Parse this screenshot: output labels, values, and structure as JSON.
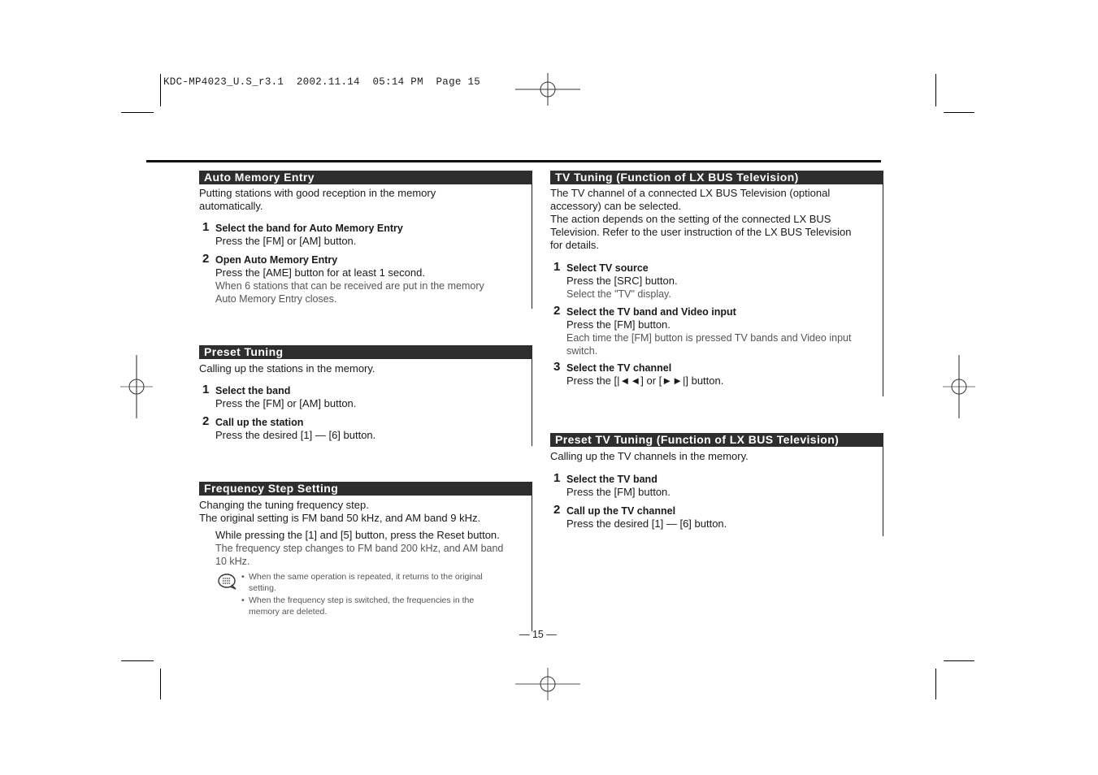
{
  "slug": {
    "file": "KDC-MP4023_U.S_r3.1",
    "date": "2002.11.14",
    "time": "05:14 PM",
    "page_label": "Page 15"
  },
  "left_column": {
    "auto_memory": {
      "title": "Auto Memory Entry",
      "intro": [
        "Putting stations with good reception in the memory",
        "automatically."
      ],
      "steps": [
        {
          "num": "1",
          "title": "Select the band for Auto Memory Entry",
          "action": "Press the [FM] or [AM] button.",
          "notes": []
        },
        {
          "num": "2",
          "title": "Open Auto Memory Entry",
          "action": "Press the [AME] button for at least 1 second.",
          "notes": [
            "When 6 stations that can be received are put in the memory",
            "Auto Memory Entry closes."
          ]
        }
      ]
    },
    "preset_tuning": {
      "title": "Preset Tuning",
      "intro": [
        "Calling up the stations in the memory."
      ],
      "steps": [
        {
          "num": "1",
          "title": "Select the band",
          "action": "Press the [FM] or [AM] button."
        },
        {
          "num": "2",
          "title": "Call up the station",
          "action": "Press the desired [1] — [6] button."
        }
      ]
    },
    "frequency_step": {
      "title": "Frequency Step Setting",
      "intro": [
        "Changing the tuning frequency step.",
        "The original setting is FM band 50 kHz, and AM band 9 kHz."
      ],
      "action": "While pressing the [1] and [5] button, press the Reset button.",
      "notes": [
        "The frequency step changes to FM band 200 kHz, and AM band",
        "10 kHz."
      ],
      "tips_icon": "note-speech-bubble-icon",
      "tips": [
        [
          "When the same operation is repeated, it returns to the original",
          "setting."
        ],
        [
          "When the frequency step is switched, the frequencies in the",
          "memory are deleted."
        ]
      ]
    }
  },
  "right_column": {
    "tv_tuning": {
      "title": "TV Tuning (Function of LX BUS Television)",
      "intro": [
        "The TV channel of a connected LX BUS Television (optional",
        "accessory) can be selected.",
        "The action depends on the setting of the connected LX BUS",
        "Television. Refer to the user instruction of the LX BUS Television",
        "for details."
      ],
      "steps": [
        {
          "num": "1",
          "title": "Select TV source",
          "action": "Press the [SRC] button.",
          "notes": [
            "Select the \"TV\" display."
          ]
        },
        {
          "num": "2",
          "title": "Select the TV band and Video input",
          "action": "Press the [FM] button.",
          "notes": [
            "Each time the [FM] button is pressed TV bands and Video input",
            "switch."
          ]
        },
        {
          "num": "3",
          "title": "Select the TV channel",
          "action": "Press the [|◄◄] or [►►|] button.",
          "notes": []
        }
      ]
    },
    "preset_tv_tuning": {
      "title": "Preset TV Tuning (Function of LX BUS Television)",
      "intro": [
        "Calling up the TV channels in the memory."
      ],
      "steps": [
        {
          "num": "1",
          "title": "Select the TV band",
          "action": "Press the [FM] button."
        },
        {
          "num": "2",
          "title": "Call up the TV channel",
          "action": "Press the desired [1] — [6] button."
        }
      ]
    }
  },
  "footer": {
    "page_number": "— 15 —"
  }
}
